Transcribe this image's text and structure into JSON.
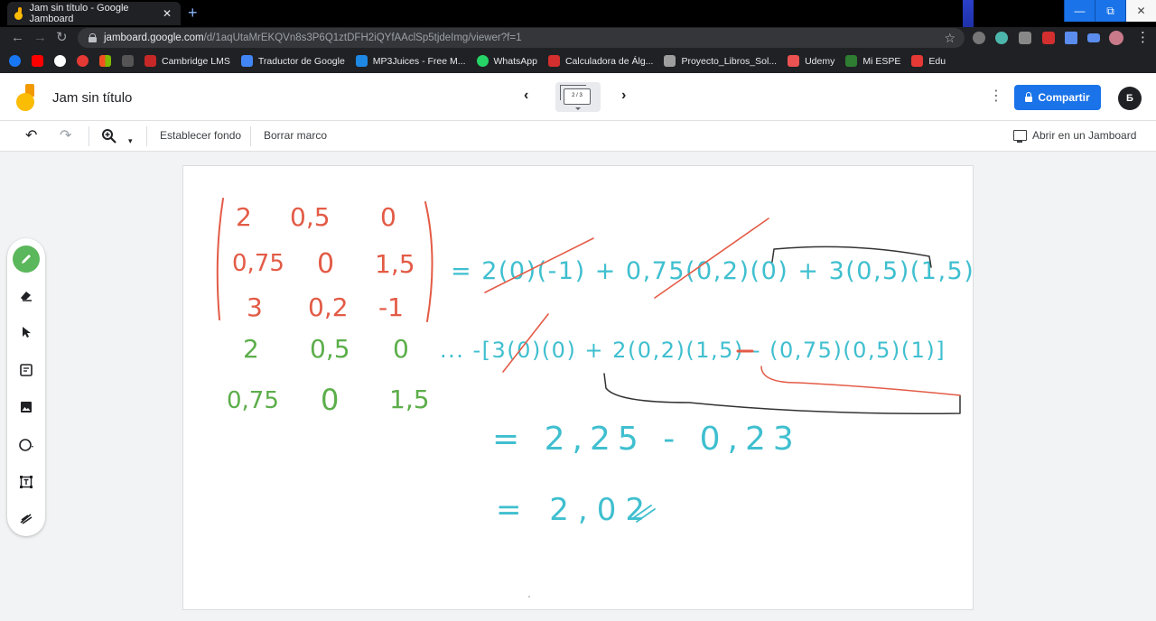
{
  "browser": {
    "tab_title": "Jam sin título - Google Jamboard",
    "tab_close": "✕",
    "new_tab": "+",
    "url_host": "jamboard.google.com",
    "url_path": "/d/1aqUtaMrEKQVn8s3P6Q1ztDFH2iQYfAAclSp5tjdeImg/viewer?f=1",
    "window_controls": [
      "—",
      "⧉",
      "✕"
    ]
  },
  "bookmarks": [
    {
      "label": "",
      "color": "#1877f2"
    },
    {
      "label": "",
      "color": "#ff0000"
    },
    {
      "label": "",
      "color": "#ffffff"
    },
    {
      "label": "",
      "color": "#e53935"
    },
    {
      "label": "",
      "color": "#f25022"
    },
    {
      "label": "",
      "color": "#555555"
    },
    {
      "label": "Cambridge LMS",
      "color": "#c62828"
    },
    {
      "label": "Traductor de Google",
      "color": "#4285f4"
    },
    {
      "label": "MP3Juices - Free M...",
      "color": "#1e88e5"
    },
    {
      "label": "WhatsApp",
      "color": "#25d366"
    },
    {
      "label": "Calculadora de Álg...",
      "color": "#d32f2f"
    },
    {
      "label": "Proyecto_Libros_Sol...",
      "color": "#9e9e9e"
    },
    {
      "label": "Udemy",
      "color": "#ec5252"
    },
    {
      "label": "Mi ESPE",
      "color": "#2e7d32"
    },
    {
      "label": "Edu",
      "color": "#e53935"
    }
  ],
  "app": {
    "title": "Jam sin título",
    "frame_indicator": "2 / 3",
    "share_label": "Compartir",
    "avatar_initial": "Б"
  },
  "toolbar": {
    "set_background": "Establecer fondo",
    "clear_frame": "Borrar marco",
    "open_in_jamboard": "Abrir en un Jamboard"
  },
  "sidebar": {
    "tools": [
      "pen-tool",
      "eraser-tool",
      "select-tool",
      "sticky-note-tool",
      "image-tool",
      "circle-shape-tool",
      "text-box-tool",
      "laser-tool"
    ]
  },
  "board": {
    "red_matrix_rows": [
      [
        "2",
        "0,5",
        "0"
      ],
      [
        "0,75",
        "0",
        "1,5"
      ],
      [
        "3",
        "0,2",
        "-1"
      ]
    ],
    "green_rows": [
      [
        "2",
        "0,5",
        "0"
      ],
      [
        "0,75",
        "0",
        "1,5"
      ]
    ],
    "line1": "= 2(0)(-1) + 0,75(0,2)(0) + 3(0,5)(1,5) ...",
    "line2": "... -[3(0)(0) + 2(0,2)(1,5) - (0,75)(0,5)(1)]",
    "line3": "= 2,25 - 0,23",
    "line4": "= 2,02",
    "colors": {
      "red": "#e35b46",
      "green": "#5cae4a",
      "cyan": "#3fbfcf",
      "black": "#333333"
    }
  }
}
